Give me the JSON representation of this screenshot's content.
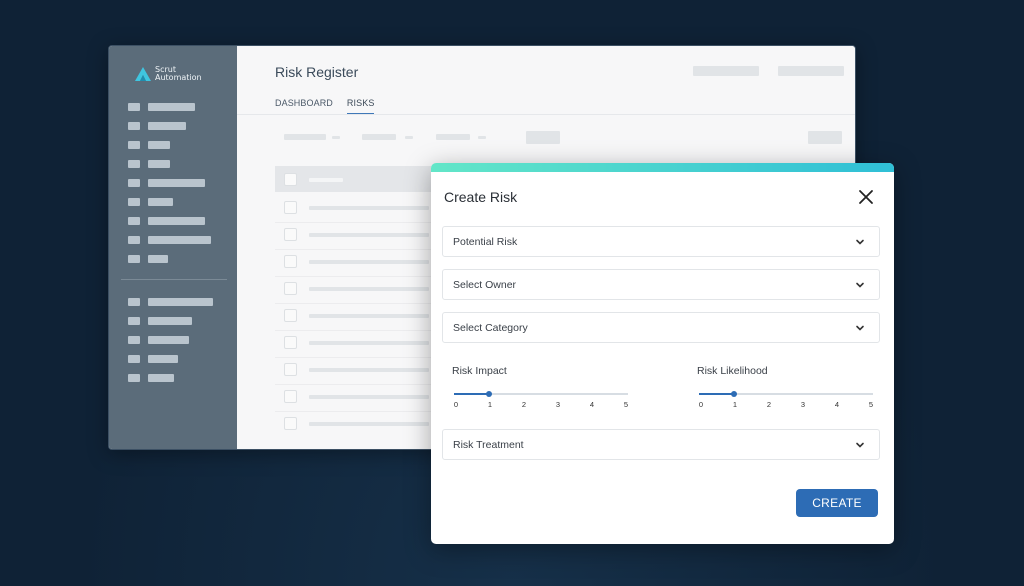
{
  "brand": {
    "line1": "Scrut",
    "line2": "Automation",
    "logo_icon": "scrut-logo-icon"
  },
  "page": {
    "title": "Risk Register"
  },
  "tabs": [
    {
      "label": "DASHBOARD",
      "active": false
    },
    {
      "label": "RISKS",
      "active": true
    }
  ],
  "dialog": {
    "title": "Create Risk",
    "close_icon": "close-icon",
    "fields": {
      "potential_risk": "Potential Risk",
      "owner": "Select Owner",
      "category": "Select Category",
      "treatment": "Risk Treatment"
    },
    "impact": {
      "label": "Risk Impact",
      "value": 1,
      "min": 0,
      "max": 5,
      "ticks": [
        "0",
        "1",
        "2",
        "3",
        "4",
        "5"
      ]
    },
    "likelihood": {
      "label": "Risk Likelihood",
      "value": 1,
      "min": 0,
      "max": 5,
      "ticks": [
        "0",
        "1",
        "2",
        "3",
        "4",
        "5"
      ]
    },
    "create_label": "CREATE"
  },
  "colors": {
    "background": "#0f2236",
    "sidebar": "#5b6c7a",
    "accent": "#2d6cb5",
    "gradient_start": "#63e6c8",
    "gradient_end": "#2fbfd6"
  }
}
